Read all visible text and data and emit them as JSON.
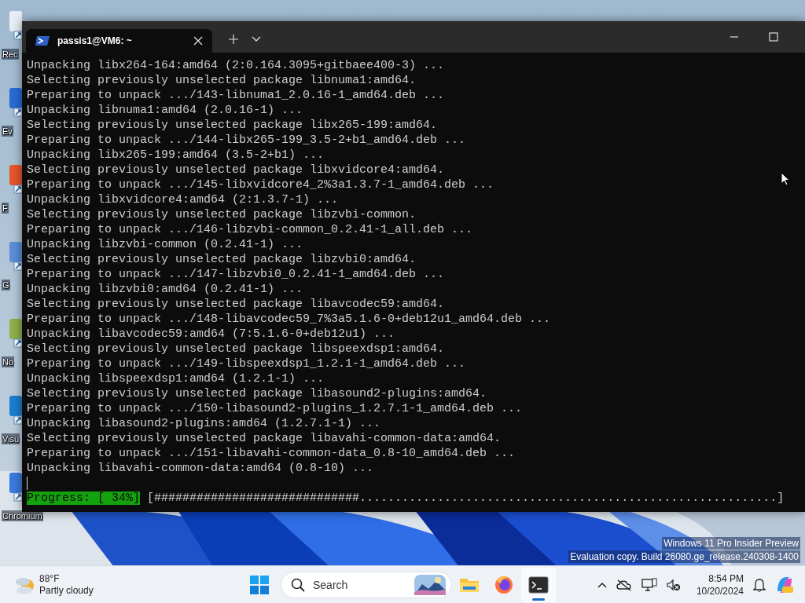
{
  "desktop_icons": [
    {
      "label": "Rec"
    },
    {
      "label": "Ev"
    },
    {
      "label": "F"
    },
    {
      "label": "G"
    },
    {
      "label": "No"
    },
    {
      "label": "Visu"
    },
    {
      "label": "Chromium"
    }
  ],
  "terminal": {
    "tab_title": "passis1@VM6: ~",
    "lines": [
      "Unpacking libx264-164:amd64 (2:0.164.3095+gitbaee400-3) ...",
      "Selecting previously unselected package libnuma1:amd64.",
      "Preparing to unpack .../143-libnuma1_2.0.16-1_amd64.deb ...",
      "Unpacking libnuma1:amd64 (2.0.16-1) ...",
      "Selecting previously unselected package libx265-199:amd64.",
      "Preparing to unpack .../144-libx265-199_3.5-2+b1_amd64.deb ...",
      "Unpacking libx265-199:amd64 (3.5-2+b1) ...",
      "Selecting previously unselected package libxvidcore4:amd64.",
      "Preparing to unpack .../145-libxvidcore4_2%3a1.3.7-1_amd64.deb ...",
      "Unpacking libxvidcore4:amd64 (2:1.3.7-1) ...",
      "Selecting previously unselected package libzvbi-common.",
      "Preparing to unpack .../146-libzvbi-common_0.2.41-1_all.deb ...",
      "Unpacking libzvbi-common (0.2.41-1) ...",
      "Selecting previously unselected package libzvbi0:amd64.",
      "Preparing to unpack .../147-libzvbi0_0.2.41-1_amd64.deb ...",
      "Unpacking libzvbi0:amd64 (0.2.41-1) ...",
      "Selecting previously unselected package libavcodec59:amd64.",
      "Preparing to unpack .../148-libavcodec59_7%3a5.1.6-0+deb12u1_amd64.deb ...",
      "Unpacking libavcodec59:amd64 (7:5.1.6-0+deb12u1) ...",
      "Selecting previously unselected package libspeexdsp1:amd64.",
      "Preparing to unpack .../149-libspeexdsp1_1.2.1-1_amd64.deb ...",
      "Unpacking libspeexdsp1:amd64 (1.2.1-1) ...",
      "Selecting previously unselected package libasound2-plugins:amd64.",
      "Preparing to unpack .../150-libasound2-plugins_1.2.7.1-1_amd64.deb ...",
      "Unpacking libasound2-plugins:amd64 (1.2.7.1-1) ...",
      "Selecting previously unselected package libavahi-common-data:amd64.",
      "Preparing to unpack .../151-libavahi-common-data_0.8-10_amd64.deb ...",
      "Unpacking libavahi-common-data:amd64 (0.8-10) ..."
    ],
    "progress": {
      "label": "Progress: [ 34%]",
      "bar": "[#############################...........................................................]"
    }
  },
  "watermark": {
    "line1": "Windows 11 Pro Insider Preview",
    "line2": "Evaluation copy. Build 26080.ge_release.240308-1400"
  },
  "taskbar": {
    "weather": {
      "temp": "88°F",
      "condition": "Partly cloudy"
    },
    "search": {
      "placeholder": "Search"
    },
    "apps": [
      {
        "kind": "explorer",
        "active": false
      },
      {
        "kind": "firefox",
        "active": false
      },
      {
        "kind": "terminal",
        "active": true
      }
    ],
    "clock": {
      "time": "8:54 PM",
      "date": "10/20/2024"
    }
  }
}
